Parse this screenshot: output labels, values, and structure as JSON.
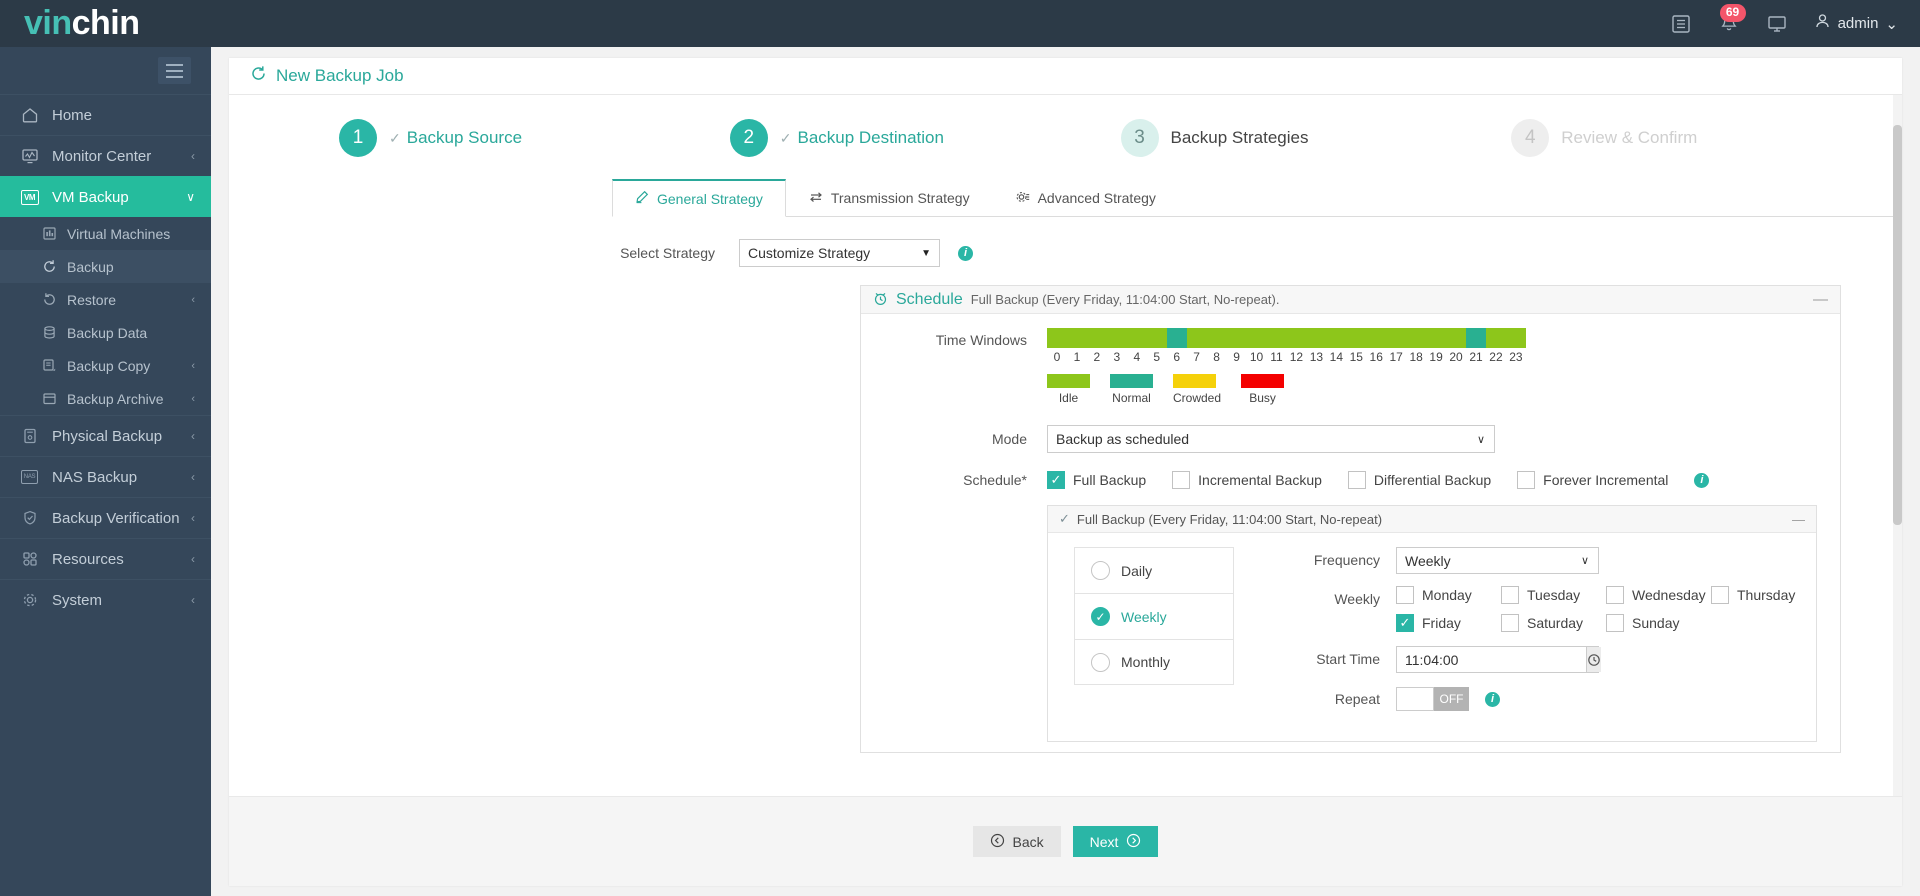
{
  "brand": {
    "part1": "vin",
    "part2": "chin"
  },
  "topbar": {
    "list_icon": "list-icon",
    "bell_icon": "bell-icon",
    "notification_count": "69",
    "monitor_icon": "monitor-icon",
    "user_icon": "user-icon",
    "user_name": "admin",
    "caret": "⌄"
  },
  "sidebar": {
    "menu_toggle": "hamburger-icon",
    "items": [
      {
        "label": "Home",
        "icon": "home-icon",
        "chevron": "",
        "active": false
      },
      {
        "label": "Monitor Center",
        "icon": "monitor-chart-icon",
        "chevron": "‹",
        "active": false
      },
      {
        "label": "VM Backup",
        "icon": "vm-icon",
        "chevron": "∨",
        "active": true
      }
    ],
    "sub_items": [
      {
        "label": "Virtual Machines",
        "icon": "grid-icon",
        "chevron": "",
        "selected": false
      },
      {
        "label": "Backup",
        "icon": "refresh-icon",
        "chevron": "",
        "selected": true
      },
      {
        "label": "Restore",
        "icon": "restore-icon",
        "chevron": "‹",
        "selected": false
      },
      {
        "label": "Backup Data",
        "icon": "database-icon",
        "chevron": "",
        "selected": false
      },
      {
        "label": "Backup Copy",
        "icon": "copy-icon",
        "chevron": "‹",
        "selected": false
      },
      {
        "label": "Backup Archive",
        "icon": "archive-icon",
        "chevron": "‹",
        "selected": false
      }
    ],
    "items_lower": [
      {
        "label": "Physical Backup",
        "icon": "server-icon",
        "chevron": "‹"
      },
      {
        "label": "NAS Backup",
        "icon": "nas-icon",
        "chevron": "‹"
      },
      {
        "label": "Backup Verification",
        "icon": "shield-check-icon",
        "chevron": "‹"
      },
      {
        "label": "Resources",
        "icon": "resources-icon",
        "chevron": "‹"
      },
      {
        "label": "System",
        "icon": "gear-icon",
        "chevron": "‹"
      }
    ]
  },
  "page": {
    "title": "New Backup Job",
    "title_icon": "refresh-icon"
  },
  "stepper": [
    {
      "num": "1",
      "label": "Backup Source",
      "state": "done",
      "tick": "✓"
    },
    {
      "num": "2",
      "label": "Backup Destination",
      "state": "done",
      "tick": "✓"
    },
    {
      "num": "3",
      "label": "Backup Strategies",
      "state": "current",
      "tick": ""
    },
    {
      "num": "4",
      "label": "Review & Confirm",
      "state": "todo",
      "tick": ""
    }
  ],
  "tabs": [
    {
      "label": "General Strategy",
      "icon": "pencil-icon",
      "active": true
    },
    {
      "label": "Transmission Strategy",
      "icon": "transfer-icon",
      "active": false
    },
    {
      "label": "Advanced Strategy",
      "icon": "gear-slider-icon",
      "active": false
    }
  ],
  "select_strategy": {
    "label": "Select Strategy",
    "value": "Customize Strategy",
    "caret": "▼",
    "info_icon": "info-icon",
    "info_glyph": "i"
  },
  "schedule_panel": {
    "icon": "alarm-clock-icon",
    "name": "Schedule",
    "description": "Full Backup (Every Friday, 11:04:00 Start, No-repeat).",
    "minimize": "—"
  },
  "time_windows": {
    "label": "Time Windows",
    "hours": [
      "0",
      "1",
      "2",
      "3",
      "4",
      "5",
      "6",
      "7",
      "8",
      "9",
      "10",
      "11",
      "12",
      "13",
      "14",
      "15",
      "16",
      "17",
      "18",
      "19",
      "20",
      "21",
      "22",
      "23"
    ],
    "states": [
      "idle",
      "idle",
      "idle",
      "idle",
      "idle",
      "idle",
      "normal",
      "idle",
      "idle",
      "idle",
      "idle",
      "idle",
      "idle",
      "idle",
      "idle",
      "idle",
      "idle",
      "idle",
      "idle",
      "idle",
      "idle",
      "normal",
      "idle",
      "idle"
    ],
    "legend": [
      {
        "label": "Idle",
        "color": "#8dc61b"
      },
      {
        "label": "Normal",
        "color": "#29b091"
      },
      {
        "label": "Crowded",
        "color": "#f5d10a"
      },
      {
        "label": "Busy",
        "color": "#f40000"
      }
    ],
    "colors": {
      "idle": "#8dc61b",
      "normal": "#29b091",
      "crowded": "#f5d10a",
      "busy": "#f40000"
    }
  },
  "mode": {
    "label": "Mode",
    "value": "Backup as scheduled",
    "caret": "∨"
  },
  "schedule_types": {
    "label": "Schedule",
    "required": "*",
    "options": [
      {
        "label": "Full Backup",
        "checked": true
      },
      {
        "label": "Incremental Backup",
        "checked": false
      },
      {
        "label": "Differential Backup",
        "checked": false
      },
      {
        "label": "Forever Incremental",
        "checked": false
      }
    ],
    "info_glyph": "i"
  },
  "full_backup_panel": {
    "tick": "✓",
    "title": "Full Backup (Every Friday, 11:04:00 Start, No-repeat)",
    "minimize": "—",
    "frequency_options": [
      {
        "label": "Daily",
        "selected": false
      },
      {
        "label": "Weekly",
        "selected": true
      },
      {
        "label": "Monthly",
        "selected": false
      }
    ],
    "frequency": {
      "label": "Frequency",
      "value": "Weekly",
      "caret": "∨"
    },
    "weekly": {
      "label": "Weekly",
      "days": [
        {
          "label": "Monday",
          "checked": false
        },
        {
          "label": "Tuesday",
          "checked": false
        },
        {
          "label": "Wednesday",
          "checked": false
        },
        {
          "label": "Thursday",
          "checked": false
        },
        {
          "label": "Friday",
          "checked": true
        },
        {
          "label": "Saturday",
          "checked": false
        },
        {
          "label": "Sunday",
          "checked": false
        }
      ]
    },
    "start_time": {
      "label": "Start Time",
      "value": "11:04:00",
      "icon": "clock-icon"
    },
    "repeat": {
      "label": "Repeat",
      "state": "OFF",
      "info_glyph": "i"
    }
  },
  "footer": {
    "back_label": "Back",
    "back_icon": "arrow-left-circle-icon",
    "next_label": "Next",
    "next_icon": "arrow-right-circle-icon"
  },
  "colors": {
    "accent": "#2ab6a6",
    "sidebar": "#35475a",
    "topbar": "#2c3a47",
    "badge": "#f4556a"
  }
}
